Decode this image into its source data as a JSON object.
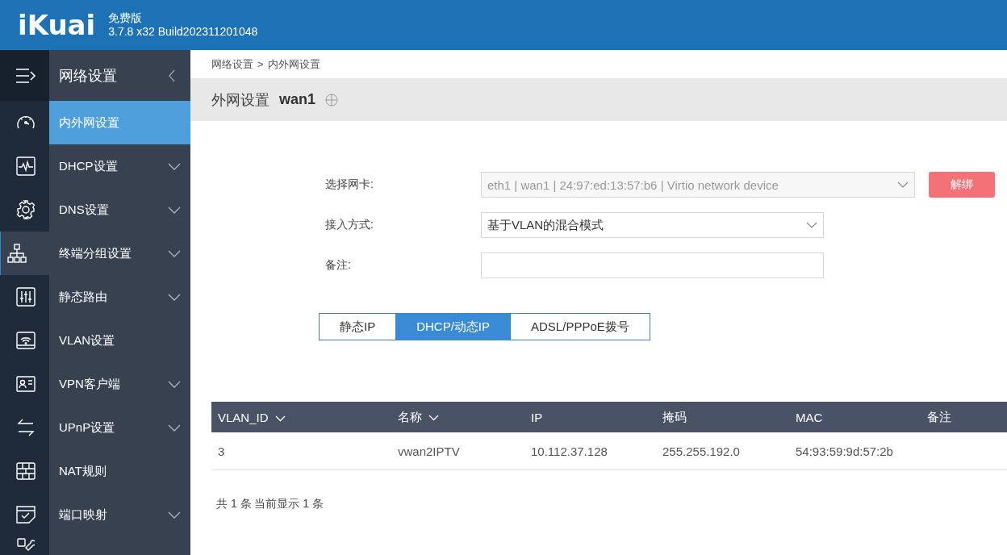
{
  "header": {
    "logo": "iKuai",
    "edition": "免费版",
    "version": "3.7.8 x32 Build202311201048"
  },
  "rail": [
    {
      "kind": "gauge",
      "selected": false
    },
    {
      "kind": "pulse",
      "selected": false
    },
    {
      "kind": "gear",
      "selected": false
    },
    {
      "kind": "network",
      "selected": true
    },
    {
      "kind": "sliders",
      "selected": false
    },
    {
      "kind": "wifi",
      "selected": false
    },
    {
      "kind": "card",
      "selected": false
    },
    {
      "kind": "arrows",
      "selected": false
    },
    {
      "kind": "wall",
      "selected": false
    },
    {
      "kind": "check",
      "selected": false
    },
    {
      "kind": "tools",
      "selected": false
    }
  ],
  "sidebar": {
    "title": "网络设置",
    "items": [
      {
        "label": "内外网设置",
        "selected": true,
        "has_submenu": false
      },
      {
        "label": "DHCP设置",
        "selected": false,
        "has_submenu": true
      },
      {
        "label": "DNS设置",
        "selected": false,
        "has_submenu": true
      },
      {
        "label": "终端分组设置",
        "selected": false,
        "has_submenu": true
      },
      {
        "label": "静态路由",
        "selected": false,
        "has_submenu": true
      },
      {
        "label": "VLAN设置",
        "selected": false,
        "has_submenu": false
      },
      {
        "label": "VPN客户端",
        "selected": false,
        "has_submenu": true
      },
      {
        "label": "UPnP设置",
        "selected": false,
        "has_submenu": true
      },
      {
        "label": "NAT规则",
        "selected": false,
        "has_submenu": false
      },
      {
        "label": "端口映射",
        "selected": false,
        "has_submenu": true
      }
    ]
  },
  "breadcrumb": {
    "parent": "网络设置",
    "separator": ">",
    "current": "内外网设置"
  },
  "page_title": {
    "label": "外网设置",
    "name": "wan1"
  },
  "form": [
    {
      "kind": "select",
      "label": "选择网卡:",
      "value": "eth1 | wan1 | 24:97:ed:13:57:b6 | Virtio network device",
      "disabled": true,
      "button": "解绑"
    },
    {
      "kind": "select",
      "label": "接入方式:",
      "value": "基于VLAN的混合模式",
      "disabled": false
    },
    {
      "kind": "text",
      "label": "备注:"
    }
  ],
  "tabs": [
    {
      "label": "静态IP",
      "selected": false
    },
    {
      "label": "DHCP/动态IP",
      "selected": true
    },
    {
      "label": "ADSL/PPPoE拨号",
      "selected": false
    }
  ],
  "table": {
    "columns": [
      {
        "label": "VLAN_ID",
        "sortable": true
      },
      {
        "label": "名称",
        "sortable": true
      },
      {
        "label": "IP",
        "sortable": false
      },
      {
        "label": "掩码",
        "sortable": false
      },
      {
        "label": "MAC",
        "sortable": false
      },
      {
        "label": "备注",
        "sortable": false
      }
    ],
    "rows": [
      [
        "3",
        "vwan2IPTV",
        "10.112.37.128",
        "255.255.192.0",
        "54:93:59:9d:57:2b"
      ]
    ]
  },
  "footer": "共 1 条 当前显示 1 条"
}
